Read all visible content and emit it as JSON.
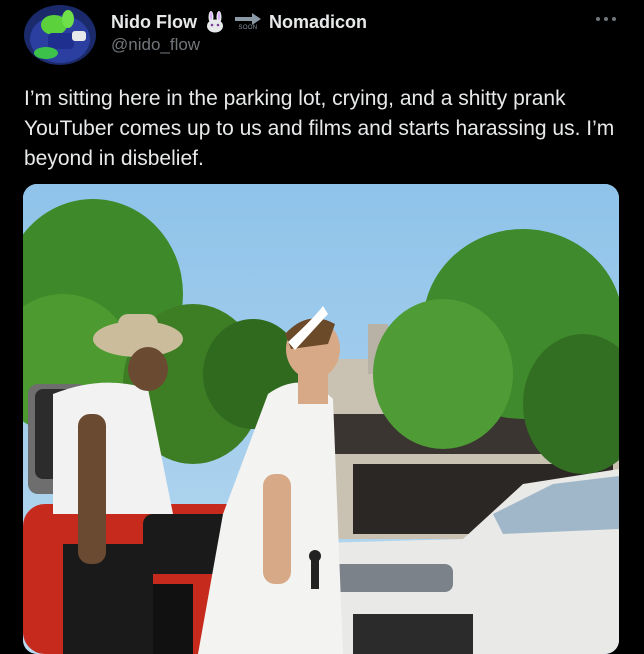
{
  "tweet": {
    "display_name": "Nido Flow",
    "secondary_name": "Nomadicon",
    "badge_small_text": "SOON",
    "handle": "@nido_flow",
    "more_icon": "ellipsis-icon",
    "text": "I’m sitting here in the parking lot, crying, and a shitty prank YouTuber comes up to us and films and starts harassing us. I’m beyond in disbelief."
  },
  "colors": {
    "background": "#000000",
    "primary_text": "#e7e9ea",
    "secondary_text": "#71767b"
  }
}
